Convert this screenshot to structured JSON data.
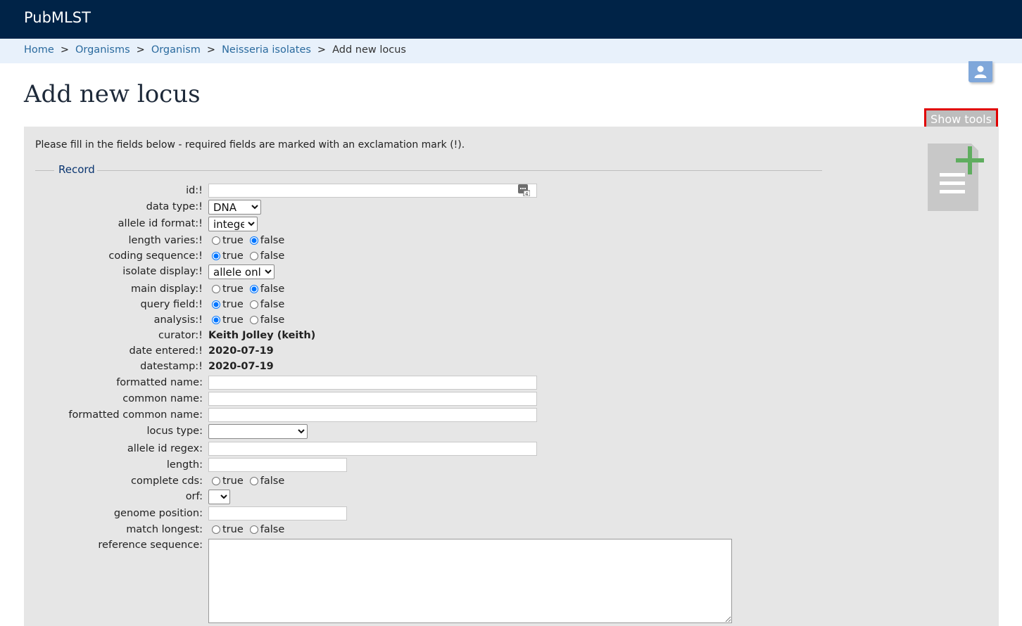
{
  "site": {
    "brand": "PubMLST"
  },
  "breadcrumb": {
    "links": [
      "Home",
      "Organisms",
      "Organism",
      "Neisseria isolates"
    ],
    "separator": ">",
    "current": "Add new locus"
  },
  "page": {
    "title": "Add new locus",
    "show_tools_label": "Show tools",
    "instructions": "Please fill in the fields below - required fields are marked with an exclamation mark (!).",
    "fieldset_legend": "Record"
  },
  "radio": {
    "true_label": "true",
    "false_label": "false"
  },
  "fields": {
    "id": {
      "label": "id:!",
      "value": ""
    },
    "data_type": {
      "label": "data type:!",
      "value": "DNA"
    },
    "allele_id_format": {
      "label": "allele id format:!",
      "value": "integer"
    },
    "length_varies": {
      "label": "length varies:!",
      "selected": "false"
    },
    "coding_sequence": {
      "label": "coding sequence:!",
      "selected": "true"
    },
    "isolate_display": {
      "label": "isolate display:!",
      "value": "allele only"
    },
    "main_display": {
      "label": "main display:!",
      "selected": "false"
    },
    "query_field": {
      "label": "query field:!",
      "selected": "true"
    },
    "analysis": {
      "label": "analysis:!",
      "selected": "true"
    },
    "curator": {
      "label": "curator:!",
      "value": "Keith Jolley (keith)"
    },
    "date_entered": {
      "label": "date entered:!",
      "value": "2020-07-19"
    },
    "datestamp": {
      "label": "datestamp:!",
      "value": "2020-07-19"
    },
    "formatted_name": {
      "label": "formatted name:",
      "value": ""
    },
    "common_name": {
      "label": "common name:",
      "value": ""
    },
    "formatted_common_name": {
      "label": "formatted common name:",
      "value": ""
    },
    "locus_type": {
      "label": "locus type:",
      "value": ""
    },
    "allele_id_regex": {
      "label": "allele id regex:",
      "value": ""
    },
    "length": {
      "label": "length:",
      "value": ""
    },
    "complete_cds": {
      "label": "complete cds:",
      "selected": ""
    },
    "orf": {
      "label": "orf:",
      "value": ""
    },
    "genome_position": {
      "label": "genome position:",
      "value": ""
    },
    "match_longest": {
      "label": "match longest:",
      "selected": ""
    },
    "reference_sequence": {
      "label": "reference sequence:",
      "value": ""
    }
  },
  "colors": {
    "header_bg": "#002347",
    "breadcrumb_bg": "#e8f1fb",
    "panel_bg": "#e6e6e6",
    "highlight": "#e00000"
  },
  "icons": {
    "avatar": "user-icon",
    "add_record": "add-document-icon",
    "id_helper": "next-id-icon"
  }
}
